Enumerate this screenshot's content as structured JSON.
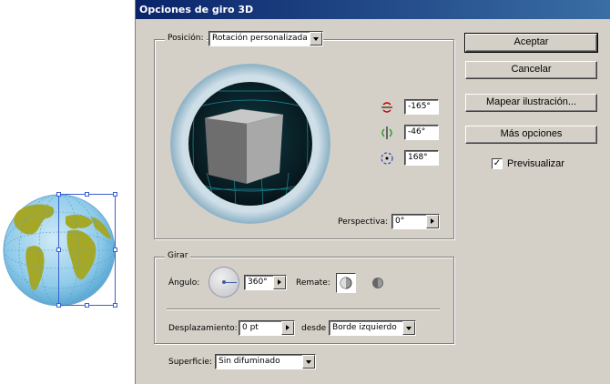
{
  "dialog": {
    "title": "Opciones de giro 3D"
  },
  "position": {
    "label": "Posición:",
    "value": "Rotación personalizada"
  },
  "rotation": {
    "x": "-165°",
    "y": "-46°",
    "z": "168°"
  },
  "perspective": {
    "label": "Perspectiva:",
    "value": "0°"
  },
  "girar": {
    "legend": "Girar",
    "angle_label": "Ángulo:",
    "angle_value": "360°",
    "remate_label": "Remate:"
  },
  "displacement": {
    "label": "Desplazamiento:",
    "value": "0 pt",
    "from_label": "desde",
    "from_value": "Borde izquierdo"
  },
  "surface": {
    "label": "Superficie:",
    "value": "Sin difuminado"
  },
  "buttons": {
    "ok": "Aceptar",
    "cancel": "Cancelar",
    "map_art": "Mapear ilustración...",
    "more_options": "Más opciones"
  },
  "preview": {
    "label": "Previsualizar",
    "checked": true,
    "mark": "✓"
  },
  "icons": {
    "x_axis": "rotate-x-icon",
    "y_axis": "rotate-y-icon",
    "z_axis": "rotate-z-icon"
  }
}
